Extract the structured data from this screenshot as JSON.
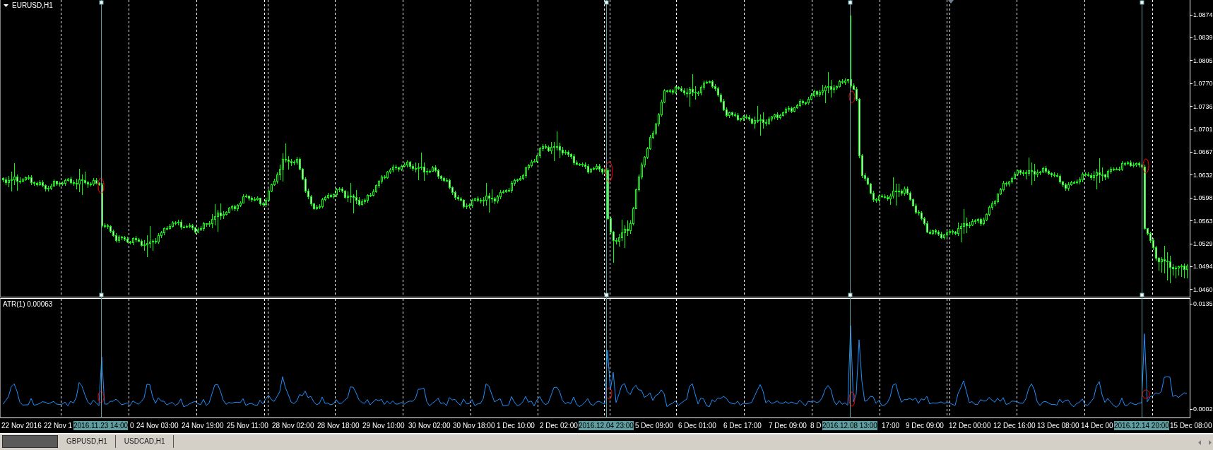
{
  "chart": {
    "title": "EURUSD,H1",
    "price_axis": [
      "1.0874",
      "1.0839",
      "1.0805",
      "1.0770",
      "1.0736",
      "1.0701",
      "1.0667",
      "1.0632",
      "1.0598",
      "1.0563",
      "1.0529",
      "1.0494",
      "1.0460"
    ]
  },
  "indicator": {
    "title": "ATR(1) 0.00063",
    "value_axis": [
      "0.0135",
      "0.0002"
    ]
  },
  "time_axis": [
    {
      "text": "22 Nov 2016",
      "kind": "tick"
    },
    {
      "text": "22 Nov 1",
      "kind": "tick"
    },
    {
      "text": "2016.11.23 14:00",
      "kind": "cursor"
    },
    {
      "text": "0",
      "kind": "tick"
    },
    {
      "text": "24 Nov 03:00",
      "kind": "tick"
    },
    {
      "text": "24 Nov 19:00",
      "kind": "tick"
    },
    {
      "text": "25 Nov 11:00",
      "kind": "tick"
    },
    {
      "text": "28 Nov 02:00",
      "kind": "tick"
    },
    {
      "text": "28 Nov 18:00",
      "kind": "tick"
    },
    {
      "text": "29 Nov 10:00",
      "kind": "tick"
    },
    {
      "text": "30 Nov 02:00",
      "kind": "tick"
    },
    {
      "text": "30 Nov 18:00",
      "kind": "tick"
    },
    {
      "text": "1 Dec 10:00",
      "kind": "tick"
    },
    {
      "text": "2 Dec 02:00",
      "kind": "tick"
    },
    {
      "text": "2016.12.04 23:00",
      "kind": "cursor"
    },
    {
      "text": "5 Dec 09:00",
      "kind": "tick"
    },
    {
      "text": "6 Dec 01:00",
      "kind": "tick"
    },
    {
      "text": "6 Dec 17:00",
      "kind": "tick"
    },
    {
      "text": "7 Dec 09:00",
      "kind": "tick"
    },
    {
      "text": "8 D",
      "kind": "tick"
    },
    {
      "text": "2016.12.08 13:00",
      "kind": "cursor"
    },
    {
      "text": "17:00",
      "kind": "tick"
    },
    {
      "text": "9 Dec 09:00",
      "kind": "tick"
    },
    {
      "text": "12 Dec 00:00",
      "kind": "tick"
    },
    {
      "text": "12 Dec 16:00",
      "kind": "tick"
    },
    {
      "text": "13 Dec 08:00",
      "kind": "tick"
    },
    {
      "text": "14 Dec 00",
      "kind": "tick"
    },
    {
      "text": "2016.12.14 20:00",
      "kind": "cursor"
    },
    {
      "text": "15 Dec 08:00",
      "kind": "tick"
    }
  ],
  "tabs": [
    {
      "selected": true
    },
    {
      "label": "GBPUSD,H1",
      "selected": false
    },
    {
      "label": "USDCAD,H1",
      "selected": false
    }
  ]
}
